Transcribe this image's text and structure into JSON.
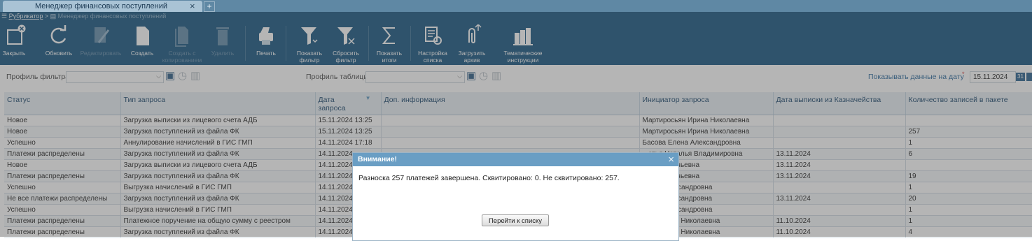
{
  "window": {
    "tab_title": "Менеджер финансовых поступлений",
    "tab_close": "×",
    "new_tab": "+"
  },
  "breadcrumb": {
    "root": "Рубрикатор",
    "sep": " > ",
    "current": "Менеджер финансовых поступлений"
  },
  "toolbar": {
    "close": "Закрыть",
    "refresh": "Обновить",
    "edit": "Редактировать",
    "create": "Создать",
    "create_copy": "Создать с копированием",
    "delete": "Удалить",
    "print": "Печать",
    "show_filter": "Показать фильтр",
    "reset_filter": "Сбросить фильтр",
    "show_totals": "Показать итоги",
    "list_settings": "Настройка списка",
    "load_archive": "Загрузить архив",
    "thematic_instructions": "Тематические инструкции"
  },
  "filters": {
    "filter_profile_label": "Профиль фильтра:",
    "table_profile_label": "Профиль таблицы:",
    "date_label": "Показывать данные на дату",
    "required_mark": "*",
    "date_value": "15.11.2024",
    "calendar_day": "31"
  },
  "table": {
    "headers": [
      "Статус",
      "Тип запроса",
      "Дата запроса",
      "Доп. информация",
      "Инициатор запроса",
      "Дата выписки из Казначейства",
      "Количество записей в пакете"
    ],
    "sort_indicator": "▼",
    "rows": [
      [
        "Новое",
        "Загрузка выписки из лицевого счета АДБ",
        "15.11.2024 13:25",
        "",
        "Мартиросьян Ирина Николаевна",
        "",
        ""
      ],
      [
        "Новое",
        "Загрузка поступлений из файла ФК",
        "15.11.2024 13:25",
        "",
        "Мартиросьян Ирина Николаевна",
        "",
        "257"
      ],
      [
        "Успешно",
        "Аннулирование начислений в ГИС ГМП",
        "14.11.2024 17:18",
        "",
        "Басова Елена Александровна",
        "",
        "1"
      ],
      [
        "Платежи распределены",
        "Загрузка поступлений из файла ФК",
        "14.11.2024",
        "",
        "...атья Наталья Владимировна",
        "13.11.2024",
        "6"
      ],
      [
        "Новое",
        "Загрузка выписки из лицевого счета АДБ",
        "14.11.2024",
        "",
        "...лия Евгеньевна",
        "13.11.2024",
        ""
      ],
      [
        "Платежи распределены",
        "Загрузка поступлений из файла ФК",
        "14.11.2024",
        "",
        "...лия Евгеньевна",
        "13.11.2024",
        "19"
      ],
      [
        "Успешно",
        "Выгрузка начислений в ГИС ГМП",
        "14.11.2024",
        "",
        "...лия Александровна",
        "",
        "1"
      ],
      [
        "Не все платежи распределены",
        "Загрузка поступлений из файла ФК",
        "14.11.2024",
        "",
        "...лья Александровна",
        "13.11.2024",
        "20"
      ],
      [
        "Успешно",
        "Выгрузка начислений в ГИС ГМП",
        "14.11.2024",
        "",
        "...лия Александровна",
        "",
        "1"
      ],
      [
        "Платежи распределены",
        "Платежное поручение на общую сумму с реестром",
        "14.11.2024",
        "",
        "...алентина Николаевна",
        "11.10.2024",
        "1"
      ],
      [
        "Платежи распределены",
        "Загрузка поступлений из файла ФК",
        "14.11.2024",
        "",
        "...алентина Николаевна",
        "11.10.2024",
        "4"
      ]
    ]
  },
  "dialog": {
    "title": "Внимание!",
    "close": "×",
    "message": "Разноска 257 платежей завершена. Сквитировано: 0. Не сквитировано: 257.",
    "button": "Перейти к списку"
  }
}
